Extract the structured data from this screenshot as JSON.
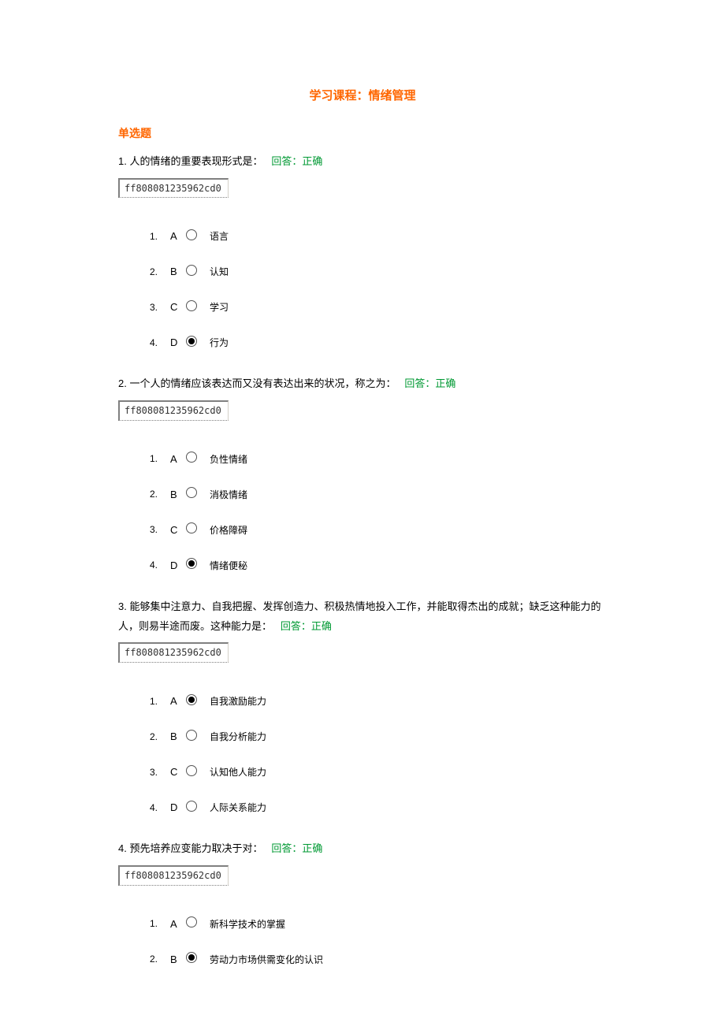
{
  "title": "学习课程：情绪管理",
  "section_heading": "单选题",
  "code_box": "ff808081235962cd0",
  "questions": [
    {
      "num": "1.",
      "text": "人的情绪的重要表现形式是：",
      "status_prefix": "回答：",
      "status": "正确",
      "options": [
        {
          "n": "1.",
          "letter": "A",
          "label": "语言",
          "selected": false
        },
        {
          "n": "2.",
          "letter": "B",
          "label": "认知",
          "selected": false
        },
        {
          "n": "3.",
          "letter": "C",
          "label": "学习",
          "selected": false
        },
        {
          "n": "4.",
          "letter": "D",
          "label": "行为",
          "selected": true
        }
      ]
    },
    {
      "num": "2.",
      "text": "一个人的情绪应该表达而又没有表达出来的状况，称之为：",
      "status_prefix": "回答：",
      "status": "正确",
      "options": [
        {
          "n": "1.",
          "letter": "A",
          "label": "负性情绪",
          "selected": false
        },
        {
          "n": "2.",
          "letter": "B",
          "label": "消极情绪",
          "selected": false
        },
        {
          "n": "3.",
          "letter": "C",
          "label": "价格障碍",
          "selected": false
        },
        {
          "n": "4.",
          "letter": "D",
          "label": "情绪便秘",
          "selected": true
        }
      ]
    },
    {
      "num": "3.",
      "text": "能够集中注意力、自我把握、发挥创造力、积极热情地投入工作，并能取得杰出的成就；缺乏这种能力的人，则易半途而废。这种能力是：",
      "status_prefix": "回答：",
      "status": "正确",
      "options": [
        {
          "n": "1.",
          "letter": "A",
          "label": "自我激励能力",
          "selected": true
        },
        {
          "n": "2.",
          "letter": "B",
          "label": "自我分析能力",
          "selected": false
        },
        {
          "n": "3.",
          "letter": "C",
          "label": "认知他人能力",
          "selected": false
        },
        {
          "n": "4.",
          "letter": "D",
          "label": "人际关系能力",
          "selected": false
        }
      ]
    },
    {
      "num": "4.",
      "text": "预先培养应变能力取决于对：",
      "status_prefix": "回答：",
      "status": "正确",
      "options": [
        {
          "n": "1.",
          "letter": "A",
          "label": "新科学技术的掌握",
          "selected": false
        },
        {
          "n": "2.",
          "letter": "B",
          "label": "劳动力市场供需变化的认识",
          "selected": true
        }
      ]
    }
  ]
}
